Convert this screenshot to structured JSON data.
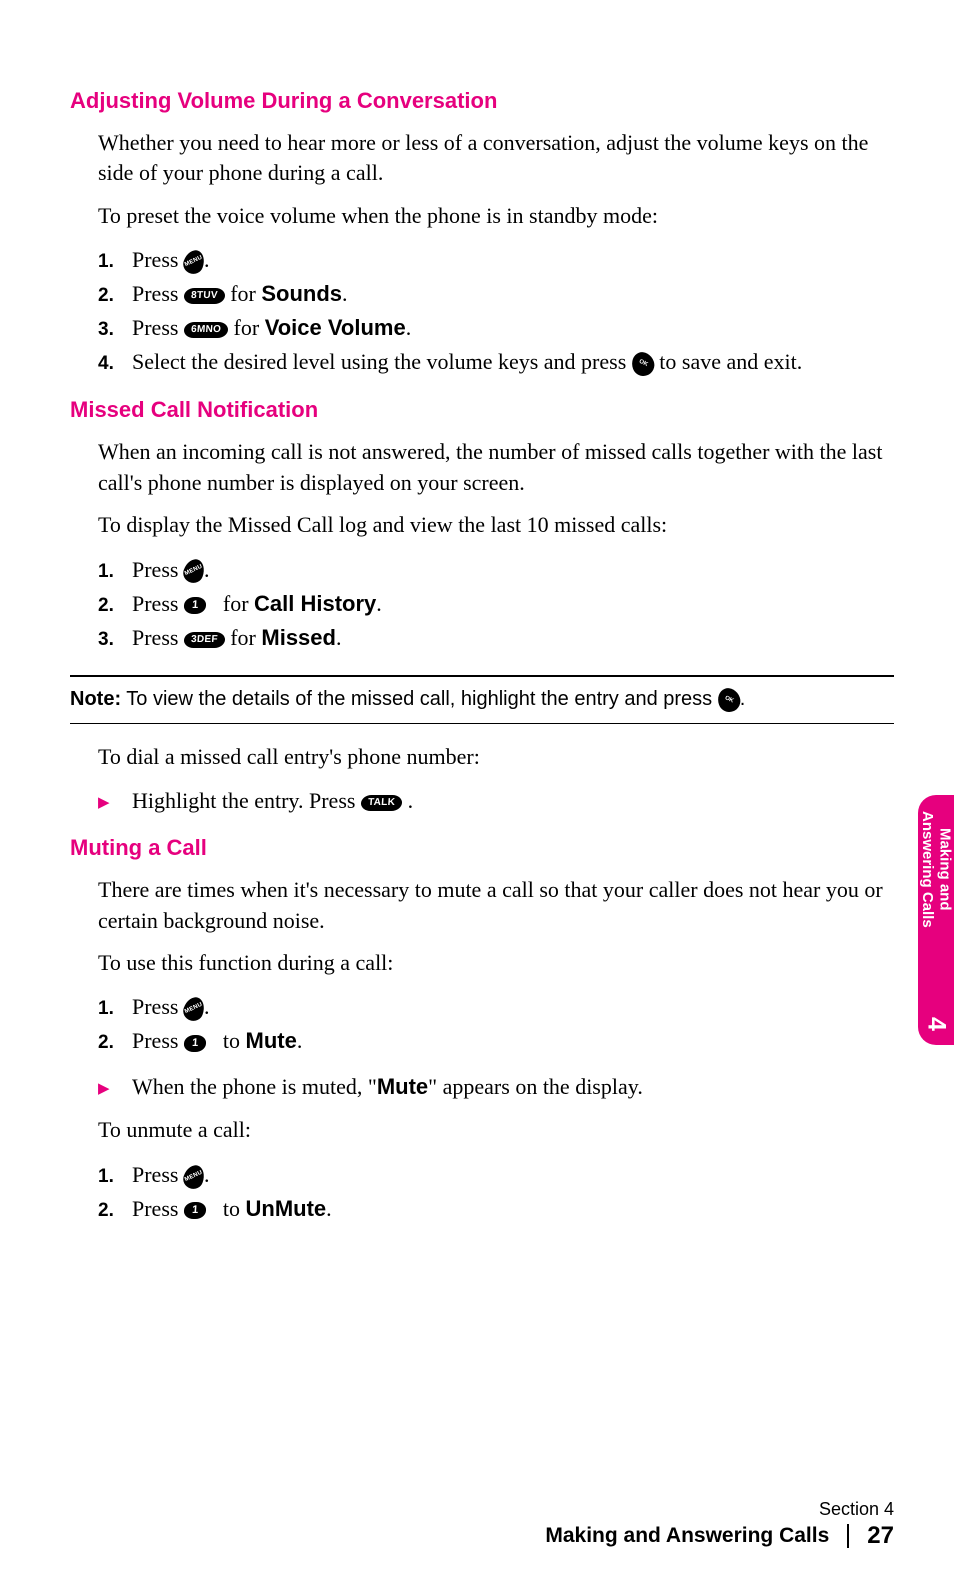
{
  "sections": {
    "s1": {
      "heading": "Adjusting Volume During a Conversation",
      "p1": "Whether you need to hear more or less of a conversation, adjust the volume keys on the side of your phone during a call.",
      "p2": "To preset the voice volume when the phone is in standby mode:",
      "steps": {
        "n1": "1.",
        "t1a": "Press ",
        "t1b": ".",
        "n2": "2.",
        "t2a": "Press ",
        "t2b": " for ",
        "t2c": "Sounds",
        "t2d": ".",
        "n3": "3.",
        "t3a": "Press ",
        "t3b": " for ",
        "t3c": "Voice Volume",
        "t3d": ".",
        "n4": "4.",
        "t4a": "Select the desired level using the volume keys and press ",
        "t4b": " to save and exit."
      }
    },
    "s2": {
      "heading": "Missed Call Notification",
      "p1": "When an incoming call is not answered, the number of missed calls together with the last call's phone number is displayed on your screen.",
      "p2": "To display the Missed Call log and view the last 10 missed calls:",
      "steps": {
        "n1": "1.",
        "t1a": "Press ",
        "t1b": ".",
        "n2": "2.",
        "t2a": "Press ",
        "t2b": " for ",
        "t2c": "Call History",
        "t2d": ".",
        "n3": "3.",
        "t3a": "Press ",
        "t3b": " for ",
        "t3c": "Missed",
        "t3d": "."
      },
      "note_label": "Note:",
      "note_a": " To view the details of the missed call, highlight the entry and press ",
      "note_b": ".",
      "p3": "To dial a missed call entry's phone number:",
      "bullet_a": "Highlight the entry. Press ",
      "bullet_b": "."
    },
    "s3": {
      "heading": "Muting a Call",
      "p1": "There are times when it's necessary to mute a call so that your caller does not hear you or certain background noise.",
      "p2": "To use this function during a call:",
      "steps_a": {
        "n1": "1.",
        "t1a": "Press ",
        "t1b": ".",
        "n2": "2.",
        "t2a": "Press ",
        "t2b": " to ",
        "t2c": "Mute",
        "t2d": "."
      },
      "bullet_a": "When the phone is muted, \"",
      "bullet_b": "Mute",
      "bullet_c": "\" appears on the display.",
      "p3": "To unmute a call:",
      "steps_b": {
        "n1": "1.",
        "t1a": "Press ",
        "t1b": ".",
        "n2": "2.",
        "t2a": "Press ",
        "t2b": " to ",
        "t2c": "UnMute",
        "t2d": "."
      }
    }
  },
  "keys": {
    "menu": "MENU",
    "ok": "OK",
    "k8": "8TUV",
    "k6": "6MNO",
    "k1": "1",
    "k3": "3DEF",
    "talk": "TALK"
  },
  "side_tab": {
    "line1": "Making and",
    "line2": "Answering Calls",
    "num": "4"
  },
  "footer": {
    "section": "Section 4",
    "title": "Making and Answering Calls",
    "page": "27"
  }
}
